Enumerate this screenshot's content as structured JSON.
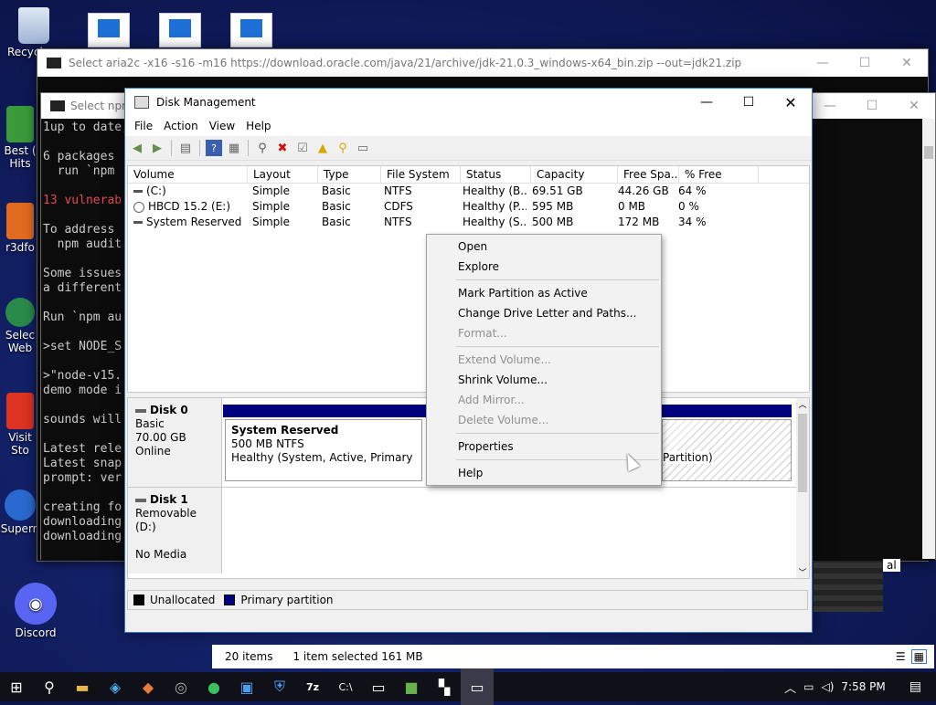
{
  "desktop": {
    "icons": [
      {
        "label": "Recycl",
        "icon": "recycle-bin-icon"
      },
      {
        "label": "Best (\nHits",
        "icon": "app-icon"
      },
      {
        "label": "r3dfo",
        "icon": "app-icon"
      },
      {
        "label": "Selec\nWeb",
        "icon": "app-icon"
      },
      {
        "label": "Visit\nSto",
        "icon": "app-icon"
      },
      {
        "label": "Supern",
        "icon": "app-icon"
      },
      {
        "label": "Discord",
        "icon": "discord-icon"
      }
    ],
    "right_label": "al"
  },
  "cmd_back": {
    "title": "Select aria2c -x16 -s16 -m16 https://download.oracle.com/java/21/archive/jdk-21.0.3_windows-x64_bin.zip --out=jdk21.zip"
  },
  "cmd_front": {
    "title": "Select npm",
    "lines": [
      "1up to date,",
      "",
      "6 packages",
      "  run `npm",
      "",
      "13 vulnerab",
      "",
      "To address",
      "  npm audit",
      "",
      "Some issues",
      "a different",
      "",
      "Run `npm au",
      "",
      ">set NODE_S",
      "",
      ">\"node-v15.",
      "demo mode i",
      "",
      "sounds will",
      "",
      "Latest rele",
      "Latest snap",
      "prompt: ver",
      "",
      "creating fo",
      "downloading",
      "downloading"
    ]
  },
  "disk_mgmt": {
    "title": "Disk Management",
    "menu": [
      "File",
      "Action",
      "View",
      "Help"
    ],
    "columns": [
      "Volume",
      "Layout",
      "Type",
      "File System",
      "Status",
      "Capacity",
      "Free Spa...",
      "% Free"
    ],
    "rows": [
      [
        "(C:)",
        "Simple",
        "Basic",
        "NTFS",
        "Healthy (B...",
        "69.51 GB",
        "44.26 GB",
        "64 %"
      ],
      [
        "HBCD 15.2 (E:)",
        "Simple",
        "Basic",
        "CDFS",
        "Healthy (P...",
        "595 MB",
        "0 MB",
        "0 %"
      ],
      [
        "System Reserved",
        "Simple",
        "Basic",
        "NTFS",
        "Healthy (S...",
        "500 MB",
        "172 MB",
        "34 %"
      ]
    ],
    "disk0": {
      "name": "Disk 0",
      "type": "Basic",
      "size": "70.00 GB",
      "state": "Online"
    },
    "partition": {
      "name": "System Reserved",
      "size": "500 MB NTFS",
      "status": "Healthy (System, Active, Primary Partiti"
    },
    "partition2_tail": "Partition)",
    "disk1": {
      "name": "Disk 1",
      "type": "Removable (D:)",
      "state": "No Media"
    },
    "legend": [
      "Unallocated",
      "Primary partition"
    ],
    "colors": {
      "unallocated": "#000000",
      "primary": "#00007f"
    }
  },
  "context_menu": {
    "items": [
      {
        "label": "Open",
        "disabled": false
      },
      {
        "label": "Explore",
        "disabled": false
      },
      {
        "sep": true
      },
      {
        "label": "Mark Partition as Active",
        "disabled": false
      },
      {
        "label": "Change Drive Letter and Paths...",
        "disabled": false
      },
      {
        "label": "Format...",
        "disabled": true
      },
      {
        "sep": true
      },
      {
        "label": "Extend Volume...",
        "disabled": true
      },
      {
        "label": "Shrink Volume...",
        "disabled": false
      },
      {
        "label": "Add Mirror...",
        "disabled": true
      },
      {
        "label": "Delete Volume...",
        "disabled": true
      },
      {
        "sep": true
      },
      {
        "label": "Properties",
        "disabled": false
      },
      {
        "sep": true
      },
      {
        "label": "Help",
        "disabled": false
      }
    ]
  },
  "explorer_status": {
    "count": "20 items",
    "selected": "1 item selected  161 MB"
  },
  "taskbar": {
    "time": "7:58 PM"
  }
}
